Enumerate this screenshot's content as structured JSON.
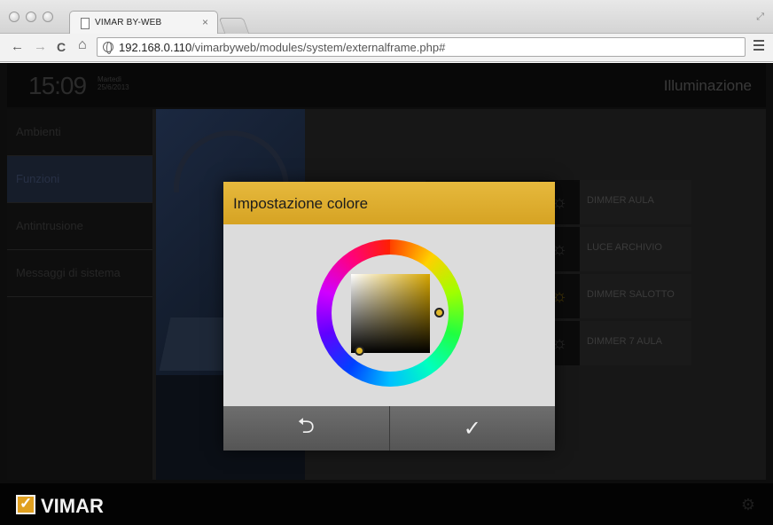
{
  "browser": {
    "tab_title": "VIMAR BY-WEB",
    "tab_close": "×",
    "url_host": "192.168.0.110",
    "url_path": "/vimarbyweb/modules/system/externalframe.php#",
    "icons": {
      "back": "←",
      "forward": "→",
      "reload": "C",
      "home": "⌂",
      "resize": "⤢"
    }
  },
  "app": {
    "header": {
      "time": "15:09",
      "weekday": "Martedì",
      "date": "25/6/2013",
      "page_title": "Illuminazione"
    },
    "sidebar": {
      "items": [
        {
          "label": "Ambienti",
          "active": false
        },
        {
          "label": "Funzioni",
          "active": true
        },
        {
          "label": "Antintrusione",
          "active": false
        },
        {
          "label": "Messaggi di sistema",
          "active": false
        }
      ]
    },
    "devices": [
      {
        "label": "DIMMER AULA",
        "on": false
      },
      {
        "label": "LUCE ARCHIVIO",
        "on": false
      },
      {
        "label": "DIMMER SALOTTO",
        "on": true
      },
      {
        "label": "DIMMER 7 AULA",
        "on": false
      }
    ],
    "footer": {
      "logo_text": "VIMAR",
      "gear_icon": "⚙"
    }
  },
  "modal": {
    "title": "Impostazione colore",
    "back_icon": "⮌",
    "confirm_icon": "✓",
    "colors": {
      "header": "#d9a82a",
      "selected_hue": "#d6a600"
    }
  }
}
